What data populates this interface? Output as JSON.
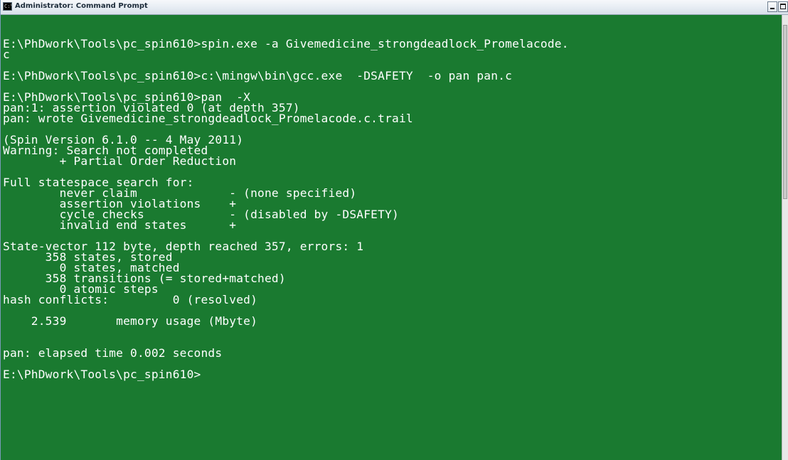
{
  "window": {
    "title": "Administrator: Command Prompt",
    "icon_glyph": "C:\\",
    "background_color": "#1a7a30",
    "text_color": "#ffffff"
  },
  "controls": {
    "minimize_icon": "minimize-icon",
    "maximize_icon": "maximize-icon"
  },
  "console": {
    "lines": [
      "E:\\PhDwork\\Tools\\pc_spin610>spin.exe -a Givemedicine_strongdeadlock_Promelacode.",
      "c",
      "",
      "E:\\PhDwork\\Tools\\pc_spin610>c:\\mingw\\bin\\gcc.exe  -DSAFETY  -o pan pan.c",
      "",
      "E:\\PhDwork\\Tools\\pc_spin610>pan  -X",
      "pan:1: assertion violated 0 (at depth 357)",
      "pan: wrote Givemedicine_strongdeadlock_Promelacode.c.trail",
      "",
      "(Spin Version 6.1.0 -- 4 May 2011)",
      "Warning: Search not completed",
      "        + Partial Order Reduction",
      "",
      "Full statespace search for:",
      "        never claim             - (none specified)",
      "        assertion violations    +",
      "        cycle checks            - (disabled by -DSAFETY)",
      "        invalid end states      +",
      "",
      "State-vector 112 byte, depth reached 357, errors: 1",
      "      358 states, stored",
      "        0 states, matched",
      "      358 transitions (= stored+matched)",
      "        0 atomic steps",
      "hash conflicts:         0 (resolved)",
      "",
      "    2.539       memory usage (Mbyte)",
      "",
      "",
      "pan: elapsed time 0.002 seconds",
      "",
      "E:\\PhDwork\\Tools\\pc_spin610>"
    ]
  }
}
